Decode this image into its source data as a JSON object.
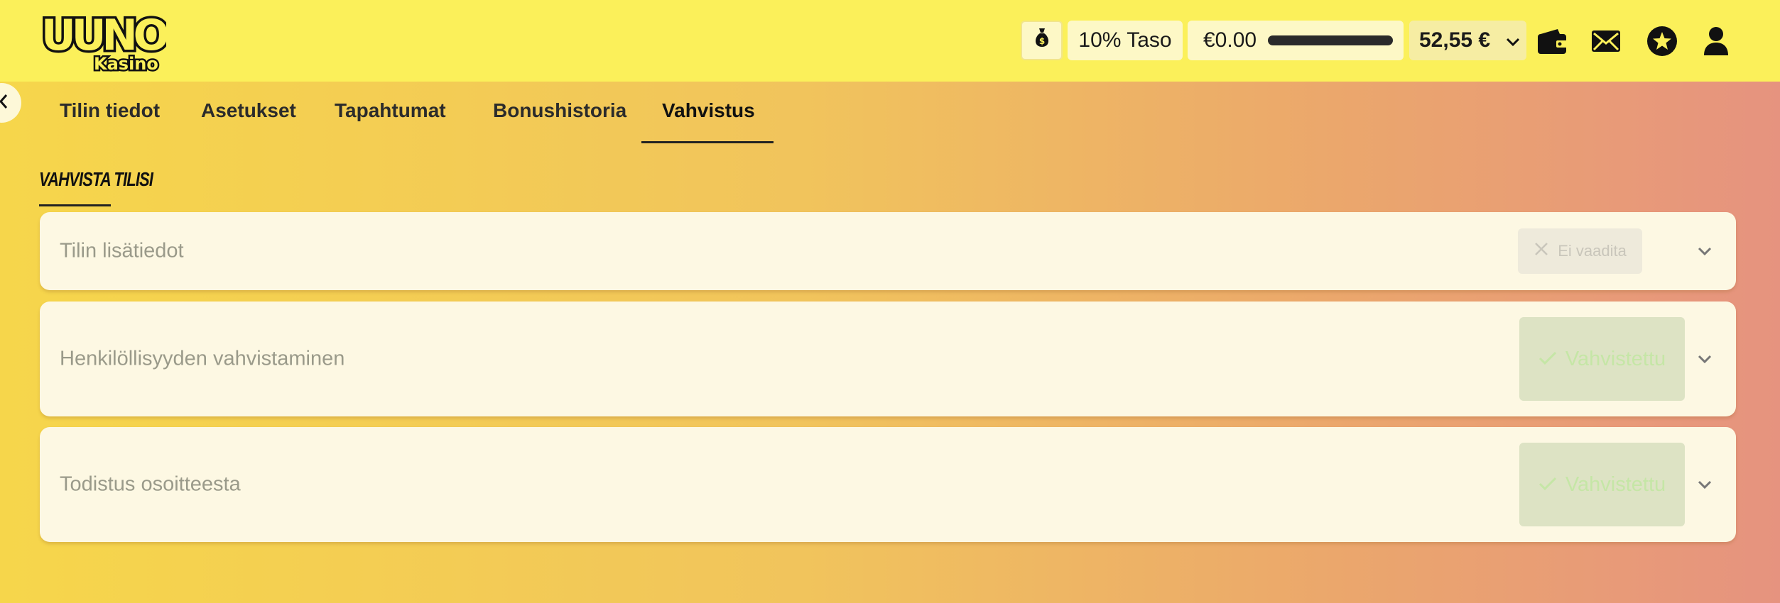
{
  "header": {
    "logo_text_top": "UUNO",
    "logo_text_bottom": "Kasino",
    "level_label": "10% Taso",
    "balance_label": "€0.00",
    "wallet_amount": "52,55 €",
    "icons": [
      "money-bag-icon",
      "chevron-down-icon",
      "wallet-icon",
      "mail-icon",
      "star-icon",
      "user-icon"
    ]
  },
  "tabs": [
    {
      "label": "Tilin tiedot",
      "active": false
    },
    {
      "label": "Asetukset",
      "active": false
    },
    {
      "label": "Tapahtumat",
      "active": false
    },
    {
      "label": "Bonushistoria",
      "active": false
    },
    {
      "label": "Vahvistus",
      "active": true
    }
  ],
  "section": {
    "title": "VAHVISTA TILISI"
  },
  "verification_items": [
    {
      "label": "Tilin lisätiedot",
      "status": "Ei vaadita",
      "status_type": "not-required"
    },
    {
      "label": "Henkilöllisyyden vahvistaminen",
      "status": "Vahvistettu",
      "status_type": "verified"
    },
    {
      "label": "Todistus osoitteesta",
      "status": "Vahvistettu",
      "status_type": "verified"
    }
  ],
  "colors": {
    "header_bg": "#fbf05a",
    "card_bg": "#fdf8e3",
    "verified_text": "#c5e6a6",
    "verified_bg": "#dde3c4"
  }
}
